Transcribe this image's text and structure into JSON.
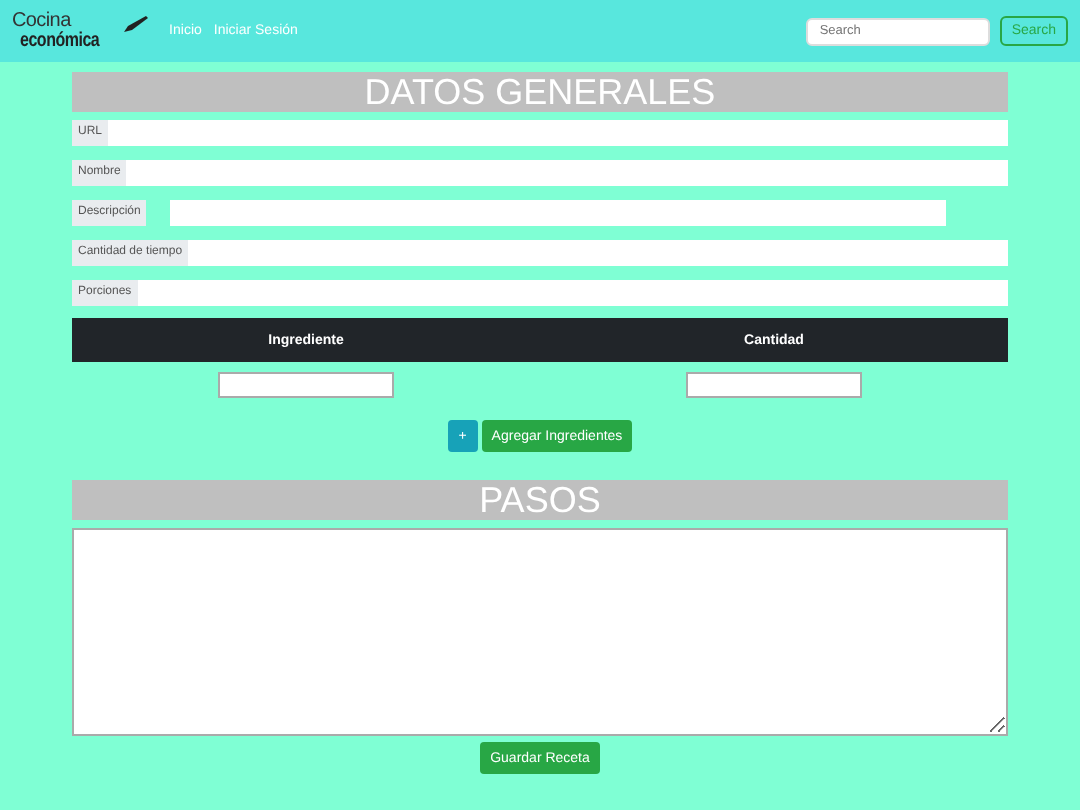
{
  "navbar": {
    "brand": [
      "Cocina",
      "económica"
    ],
    "links": [
      "Inicio",
      "Iniciar Sesión"
    ],
    "search": {
      "placeholder": "Search",
      "button": "Search"
    }
  },
  "general": {
    "title": "DATOS GENERALES",
    "fields": [
      {
        "label": "URL",
        "kind": "full"
      },
      {
        "label": "Nombre",
        "kind": "full"
      },
      {
        "label": "Descripción",
        "kind": "short"
      },
      {
        "label": "Cantidad de tiempo",
        "kind": "full"
      },
      {
        "label": "Porciones",
        "kind": "full"
      }
    ]
  },
  "ingredients": {
    "columns": [
      "Ingrediente",
      "Cantidad"
    ],
    "add_button": "+",
    "add_label": "Agregar Ingredientes"
  },
  "steps": {
    "title": "PASOS"
  },
  "save_button": "Guardar Receta"
}
